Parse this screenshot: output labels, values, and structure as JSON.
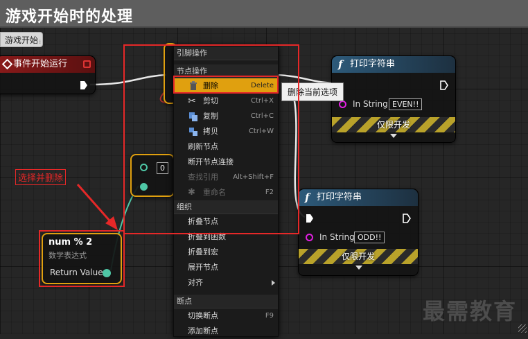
{
  "comment": {
    "title": "游戏开始时的处理",
    "tag": "游戏开始"
  },
  "event_node": {
    "title": "事件开始运行"
  },
  "print_node_even": {
    "title": "打印字符串",
    "pin_label": "In String",
    "value": "EVEN!!",
    "dev_only": "仅限开发"
  },
  "print_node_odd": {
    "title": "打印字符串",
    "pin_label": "In String",
    "value": "ODD!!",
    "dev_only": "仅限开发"
  },
  "branch_node": {
    "value": "0"
  },
  "math_node": {
    "title": "num % 2",
    "subtitle": "数学表达式",
    "return_label": "Return Value"
  },
  "context_menu": {
    "section_pin": "引脚操作",
    "section_node": "节点操作",
    "delete": "删除",
    "delete_sc": "Delete",
    "cut": "剪切",
    "cut_sc": "Ctrl+X",
    "copy": "复制",
    "copy_sc": "Ctrl+C",
    "duplicate": "拷贝",
    "duplicate_sc": "Ctrl+W",
    "refresh": "刷新节点",
    "break_links": "断开节点连接",
    "find_refs": "查找引用",
    "find_refs_sc": "Alt+Shift+F",
    "rename": "重命名",
    "rename_sc": "F2",
    "section_org": "组织",
    "collapse": "折叠节点",
    "collapse_func": "折叠到函数",
    "collapse_macro": "折叠到宏",
    "expand": "展开节点",
    "align": "对齐",
    "section_bp": "断点",
    "toggle_bp": "切换断点",
    "toggle_bp_sc": "F9",
    "add_bp": "添加断点"
  },
  "tooltip": "删除当前选项",
  "annotation": "选择并删除",
  "watermark": "最需教育",
  "colors": {
    "accent_orange": "#e0a00f",
    "annotation_red": "#e62828",
    "print_header": "#2d5a7a",
    "event_header": "#7a1414"
  }
}
